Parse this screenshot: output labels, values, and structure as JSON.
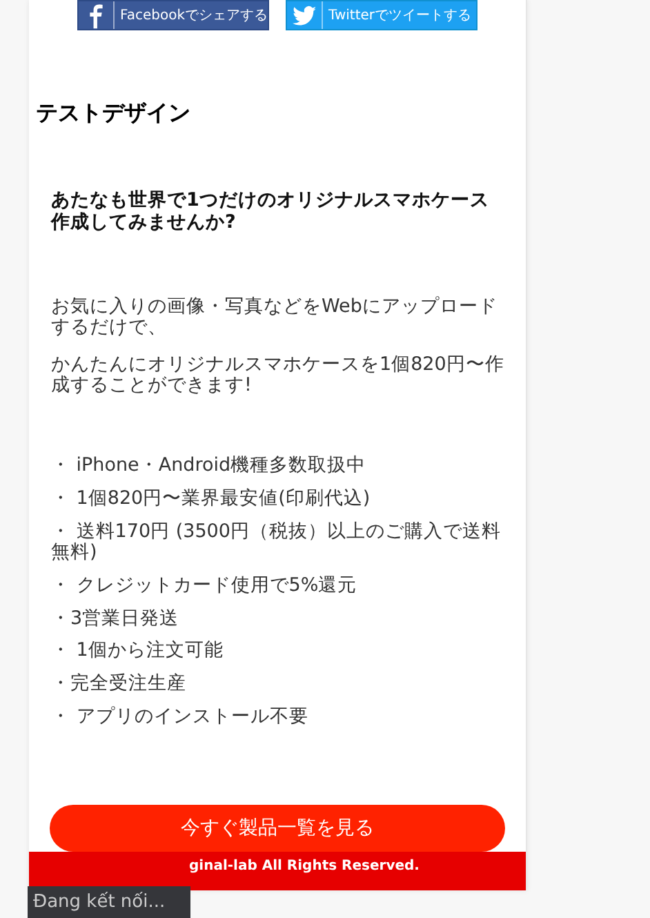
{
  "share_buttons": [
    {
      "kind": "facebook",
      "label": "Facebookでシェアする"
    },
    {
      "kind": "twitter",
      "label": "Twitterでツイートする"
    }
  ],
  "title": "テストデザイン",
  "headline": "あたなも世界で1つだけのオリジナルスマホケース作成してみませんか?",
  "paragraphs": [
    "お気に入りの画像・写真などをWebにアップロードするだけで、",
    "かんたんにオリジナルスマホケースを1個820円〜作成することができます!"
  ],
  "features": [
    "・ iPhone・Android機種多数取扱中",
    "・ 1個820円〜業界最安値(印刷代込)",
    "・ 送料170円 (3500円（税抜）以上のご購入で送料無料)",
    "・ クレジットカード使用で5%還元",
    "・3営業日発送",
    "・ 1個から注文可能",
    "・完全受注生産",
    "・ アプリのインストール不要"
  ],
  "cta_button": "今すぐ製品一覧を見る",
  "footer": "ginal-lab All Rights Reserved.",
  "status_tooltip": "Đang kết nối..."
}
